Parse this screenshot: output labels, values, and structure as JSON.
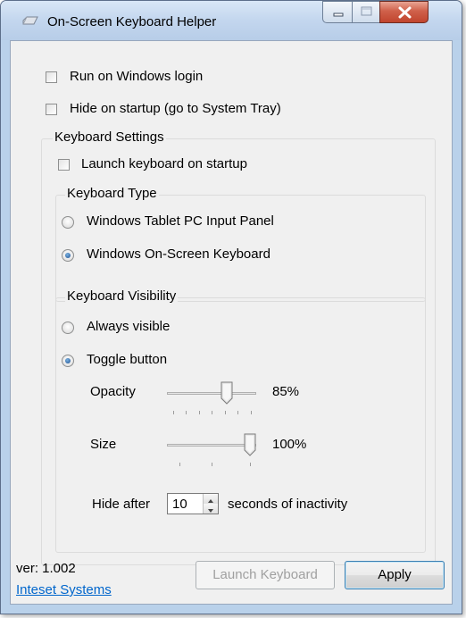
{
  "window": {
    "title": "On-Screen Keyboard Helper",
    "icons": {
      "app": "keyboard-pen-icon",
      "minimize": "minimize-icon",
      "maximize": "maximize-icon",
      "close": "close-icon"
    }
  },
  "options": {
    "run_on_login": {
      "label": "Run on Windows login",
      "checked": false
    },
    "hide_on_startup": {
      "label": "Hide on startup (go to System Tray)",
      "checked": false
    }
  },
  "keyboard_settings": {
    "title": "Keyboard Settings",
    "launch_on_startup": {
      "label": "Launch keyboard on startup",
      "checked": false
    },
    "keyboard_type": {
      "title": "Keyboard Type",
      "options": [
        {
          "label": "Windows Tablet PC Input Panel",
          "selected": false
        },
        {
          "label": "Windows On-Screen Keyboard",
          "selected": true
        }
      ]
    },
    "visibility": {
      "title": "Keyboard Visibility",
      "options": [
        {
          "label": "Always visible",
          "selected": false
        },
        {
          "label": "Toggle button",
          "selected": true
        }
      ],
      "opacity": {
        "label": "Opacity",
        "value_text": "85%",
        "value": 85
      },
      "size": {
        "label": "Size",
        "value_text": "100%",
        "value": 100
      },
      "hide_after": {
        "prefix": "Hide after",
        "value": "10",
        "suffix": "seconds of inactivity"
      }
    }
  },
  "footer": {
    "version": "ver: 1.002",
    "link": "Inteset Systems",
    "launch_button": "Launch Keyboard",
    "apply_button": "Apply"
  },
  "colors": {
    "accent": "#1c4f91",
    "link": "#0066cc",
    "close": "#c0452e",
    "frame": "#b9d1ea"
  }
}
